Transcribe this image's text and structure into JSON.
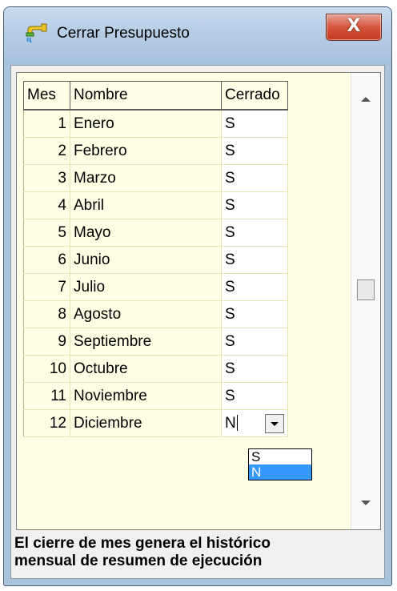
{
  "window": {
    "title": "Cerrar Presupuesto",
    "close_label": "X"
  },
  "grid": {
    "columns": [
      "Mes",
      "Nombre",
      "Cerrado"
    ],
    "rows": [
      [
        "1",
        "Enero",
        "S"
      ],
      [
        "2",
        "Febrero",
        "S"
      ],
      [
        "3",
        "Marzo",
        "S"
      ],
      [
        "4",
        "Abril",
        "S"
      ],
      [
        "5",
        "Mayo",
        "S"
      ],
      [
        "6",
        "Junio",
        "S"
      ],
      [
        "7",
        "Julio",
        "S"
      ],
      [
        "8",
        "Agosto",
        "S"
      ],
      [
        "9",
        "Septiembre",
        "S"
      ],
      [
        "10",
        "Octubre",
        "S"
      ],
      [
        "11",
        "Noviembre",
        "S"
      ],
      [
        "12",
        "Diciembre",
        "N"
      ]
    ]
  },
  "dropdown": {
    "options": [
      "S",
      "N"
    ],
    "selected": "N"
  },
  "info_lines": [
    "El cierre de mes genera el histórico",
    "mensual de resumen de ejecución"
  ],
  "icons": {
    "app": "faucet-icon",
    "close": "close-icon",
    "dropdown": "chevron-down-icon"
  },
  "colors": {
    "grid_background": "#ffffe5",
    "close_button": "#c3381f",
    "selection": "#3399ff",
    "titlebar": "#b6cde5"
  }
}
